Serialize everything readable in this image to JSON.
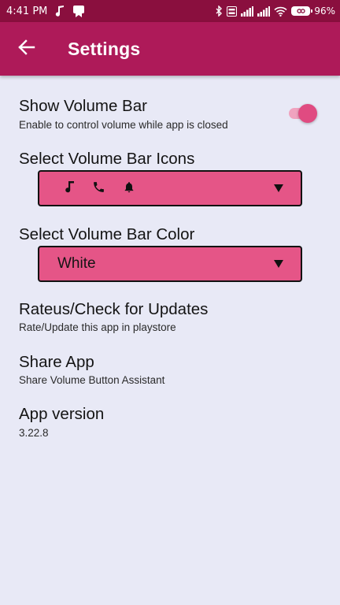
{
  "status_bar": {
    "time": "4:41 PM",
    "battery": "96%",
    "left_icons": [
      "music-note-icon",
      "notification-app-icon"
    ],
    "right_icons": [
      "bluetooth-icon",
      "volte-icon",
      "signal-icon",
      "signal-icon",
      "wifi-icon",
      "battery-icon"
    ]
  },
  "app_bar": {
    "title": "Settings",
    "back_icon": "arrow-left-icon"
  },
  "settings": {
    "show_volume_bar": {
      "title": "Show Volume Bar",
      "summary": "Enable to control volume while app is closed",
      "enabled": true
    },
    "volume_bar_icons": {
      "title": "Select Volume Bar Icons",
      "icons": [
        "music-note-icon",
        "phone-icon",
        "bell-icon"
      ]
    },
    "volume_bar_color": {
      "title": "Select Volume Bar Color",
      "value": "White"
    },
    "rate_update": {
      "title": "Rateus/Check for Updates",
      "summary": "Rate/Update this app in playstore"
    },
    "share_app": {
      "title": "Share App",
      "summary": "Share Volume Button Assistant"
    },
    "app_version": {
      "title": "App version",
      "summary": "3.22.8"
    }
  },
  "colors": {
    "status_bar": "#8a0f3e",
    "app_bar": "#ae1a59",
    "background": "#e8e9f6",
    "dropdown": "#e55587",
    "switch_thumb": "#e04b81",
    "switch_track": "#f0a3bf"
  }
}
